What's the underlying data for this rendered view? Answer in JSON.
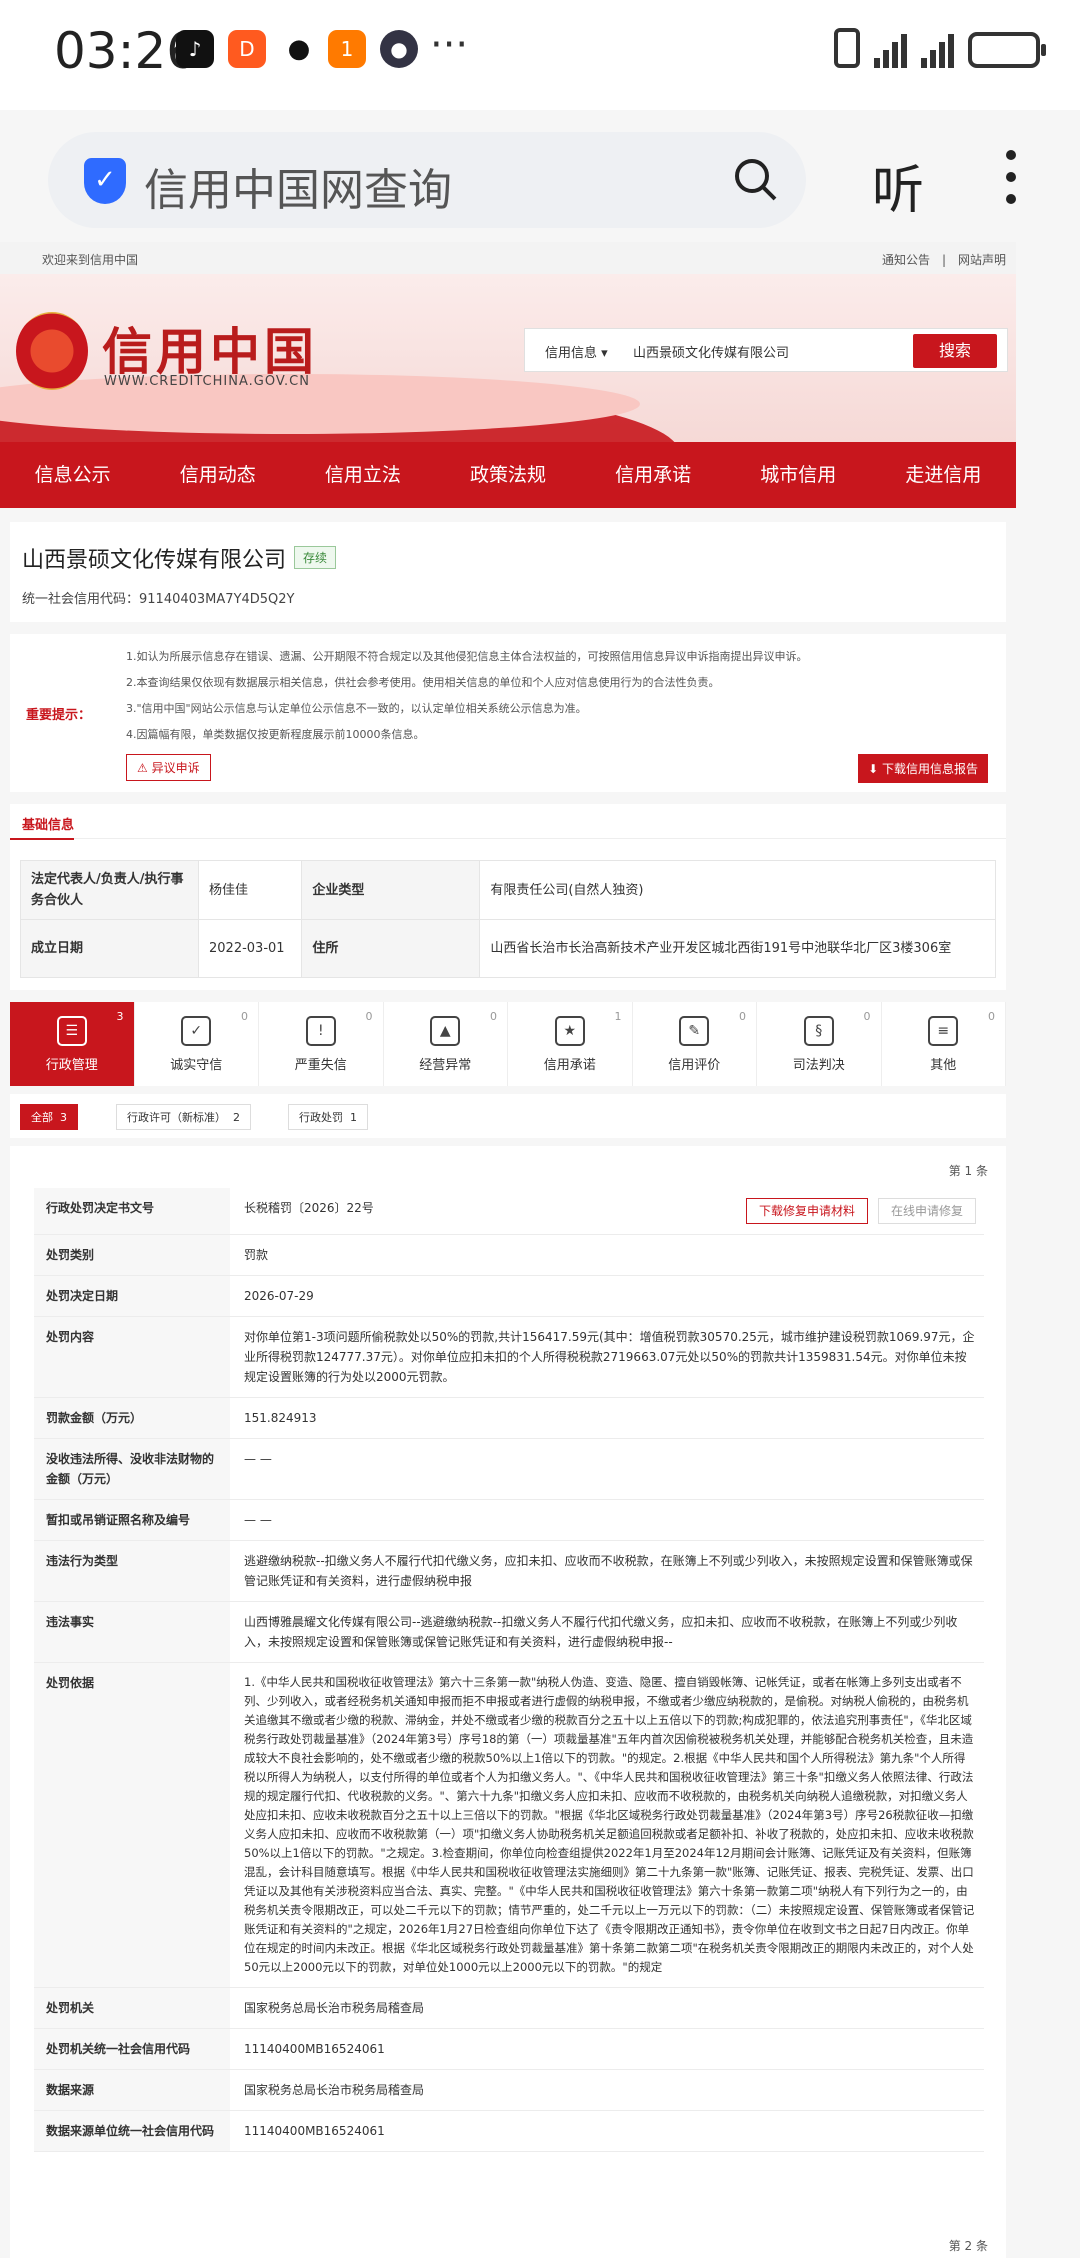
{
  "status_bar": {
    "time": "03:26",
    "more": "···",
    "battery_icon": "battery-charging-icon"
  },
  "browser": {
    "search_text": "信用中国网查询",
    "listen_label": "听"
  },
  "site": {
    "welcome": "欢迎来到信用中国",
    "links": "通知公告　|　网站声明",
    "logo_title": "信用中国",
    "logo_url": "WWW.CREDITCHINA.GOV.CN",
    "search_type": "信用信息",
    "search_value": "山西景硕文化传媒有限公司",
    "search_button": "搜索",
    "nav": [
      "信息公示",
      "信用动态",
      "信用立法",
      "政策法规",
      "信用承诺",
      "城市信用",
      "走进信用"
    ],
    "brand_color": "#c8161d"
  },
  "company": {
    "name": "山西景硕文化传媒有限公司",
    "status": "存续",
    "code_label": "统一社会信用代码：",
    "code": "91140403MA7Y4D5Q2Y"
  },
  "notice": {
    "label": "重要提示：",
    "lines": [
      "1.如认为所展示信息存在错误、遗漏、公开期限不符合规定以及其他侵犯信息主体合法权益的，可按照信用信息异议申诉指南提出异议申诉。",
      "2.本查询结果仅依现有数据展示相关信息，供社会参考使用。使用相关信息的单位和个人应对信息使用行为的合法性负责。",
      "3.\"信用中国\"网站公示信息与认定单位公示信息不一致的，以认定单位相关系统公示信息为准。",
      "4.因篇幅有限，单类数据仅按更新程度展示前10000条信息。"
    ],
    "objection_button": "异议申诉",
    "download_button": "下载信用信息报告"
  },
  "basic": {
    "title": "基础信息",
    "rows": [
      {
        "k1": "法定代表人/负责人/执行事务合伙人",
        "v1": "杨佳佳",
        "k2": "企业类型",
        "v2": "有限责任公司(自然人独资)"
      },
      {
        "k1": "成立日期",
        "v1": "2022-03-01",
        "k2": "住所",
        "v2": "山西省长治市长治高新技术产业开发区城北西街191号中池联华北厂区3楼306室"
      }
    ]
  },
  "tabs": [
    {
      "label": "行政管理",
      "count": "3",
      "icon": "admin-doc-icon",
      "glyph": "☰"
    },
    {
      "label": "诚实守信",
      "count": "0",
      "icon": "shield-check-icon",
      "glyph": "✓"
    },
    {
      "label": "严重失信",
      "count": "0",
      "icon": "warning-card-icon",
      "glyph": "!"
    },
    {
      "label": "经营异常",
      "count": "0",
      "icon": "alarm-icon",
      "glyph": "▲"
    },
    {
      "label": "信用承诺",
      "count": "1",
      "icon": "promise-doc-icon",
      "glyph": "★"
    },
    {
      "label": "信用评价",
      "count": "0",
      "icon": "evaluation-icon",
      "glyph": "✎"
    },
    {
      "label": "司法判决",
      "count": "0",
      "icon": "judgement-icon",
      "glyph": "§"
    },
    {
      "label": "其他",
      "count": "0",
      "icon": "other-doc-icon",
      "glyph": "≡"
    }
  ],
  "filters": [
    {
      "label": "全部",
      "count": "3"
    },
    {
      "label": "行政许可（新标准）",
      "count": "2"
    },
    {
      "label": "行政处罚",
      "count": "1"
    }
  ],
  "record": {
    "count_top": "第 1 条",
    "count_bottom": "第 2 条",
    "download_repair": "下载修复申请材料",
    "online_repair": "在线申请修复",
    "rows": [
      {
        "k": "行政处罚决定书文号",
        "v": "长税稽罚〔2026〕22号"
      },
      {
        "k": "处罚类别",
        "v": "罚款"
      },
      {
        "k": "处罚决定日期",
        "v": "2026-07-29"
      },
      {
        "k": "处罚内容",
        "v": "对你单位第1-3项问题所偷税款处以50%的罚款,共计156417.59元(其中：增值税罚款30570.25元，城市维护建设税罚款1069.97元，企业所得税罚款124777.37元）。对你单位应扣未扣的个人所得税税款2719663.07元处以50%的罚款共计1359831.54元。对你单位未按规定设置账簿的行为处以2000元罚款。"
      },
      {
        "k": "罚款金额（万元）",
        "v": "151.824913"
      },
      {
        "k": "没收违法所得、没收非法财物的金额（万元）",
        "v": "— —"
      },
      {
        "k": "暂扣或吊销证照名称及编号",
        "v": "— —"
      },
      {
        "k": "违法行为类型",
        "v": "逃避缴纳税款--扣缴义务人不履行代扣代缴义务，应扣未扣、应收而不收税款，在账簿上不列或少列收入，未按照规定设置和保管账簿或保管记账凭证和有关资料，进行虚假纳税申报"
      },
      {
        "k": "违法事实",
        "v": "山西博雅晨耀文化传媒有限公司--逃避缴纳税款--扣缴义务人不履行代扣代缴义务，应扣未扣、应收而不收税款，在账簿上不列或少列收入，未按照规定设置和保管账簿或保管记账凭证和有关资料，进行虚假纳税申报--"
      },
      {
        "k": "处罚依据",
        "v": "1.《中华人民共和国税收征收管理法》第六十三条第一款\"纳税人伪造、变造、隐匿、擅自销毁帐簿、记帐凭证，或者在帐簿上多列支出或者不列、少列收入，或者经税务机关通知申报而拒不申报或者进行虚假的纳税申报，不缴或者少缴应纳税款的，是偷税。对纳税人偷税的，由税务机关追缴其不缴或者少缴的税款、滞纳金，并处不缴或者少缴的税款百分之五十以上五倍以下的罚款;构成犯罪的，依法追究刑事责任\"，《华北区域税务行政处罚裁量基准》（2024年第3号）序号18的第（一）项裁量基准\"五年内首次因偷税被税务机关处理，并能够配合税务机关检查，且未造成较大不良社会影响的，处不缴或者少缴的税款50%以上1倍以下的罚款。\"的规定。2.根据《中华人民共和国个人所得税法》第九条\"个人所得税以所得人为纳税人，以支付所得的单位或者个人为扣缴义务人。\"、《中华人民共和国税收征收管理法》第三十条\"扣缴义务人依照法律、行政法规的规定履行代扣、代收税款的义务。\"、第六十九条\"扣缴义务人应扣未扣、应收而不收税款的，由税务机关向纳税人追缴税款，对扣缴义务人处应扣未扣、应收未收税款百分之五十以上三倍以下的罚款。\"根据《华北区域税务行政处罚裁量基准》（2024年第3号）序号26税款征收—扣缴义务人应扣未扣、应收而不收税款第（一）项\"扣缴义务人协助税务机关足额追回税款或者足额补扣、补收了税款的，处应扣未扣、应收未收税款50%以上1倍以下的罚款。\"之规定。3.检查期间，你单位向检查组提供2022年1月至2024年12月期间会计账簿、记账凭证及有关资料，但账簿混乱，会计科目随意填写。根据《中华人民共和国税收征收管理法实施细则》第二十九条第一款\"账簿、记账凭证、报表、完税凭证、发票、出口凭证以及其他有关涉税资料应当合法、真实、完整。\"《中华人民共和国税收征收管理法》第六十条第一款第二项\"纳税人有下列行为之一的，由税务机关责令限期改正，可以处二千元以下的罚款；情节严重的，处二千元以上一万元以下的罚款：（二）未按照规定设置、保管账簿或者保管记账凭证和有关资料的\"之规定，2026年1月27日检查组向你单位下达了《责令限期改正通知书》，责令你单位在收到文书之日起7日内改正。你单位在规定的时间内未改正。根据《华北区域税务行政处罚裁量基准》第十条第二款第二项\"在税务机关责令限期改正的期限内未改正的，对个人处50元以上2000元以下的罚款，对单位处1000元以上2000元以下的罚款。\"的规定"
      },
      {
        "k": "处罚机关",
        "v": "国家税务总局长治市税务局稽查局"
      },
      {
        "k": "处罚机关统一社会信用代码",
        "v": "11140400MB16524061"
      },
      {
        "k": "数据来源",
        "v": "国家税务总局长治市税务局稽查局"
      },
      {
        "k": "数据来源单位统一社会信用代码",
        "v": "11140400MB16524061"
      }
    ]
  }
}
